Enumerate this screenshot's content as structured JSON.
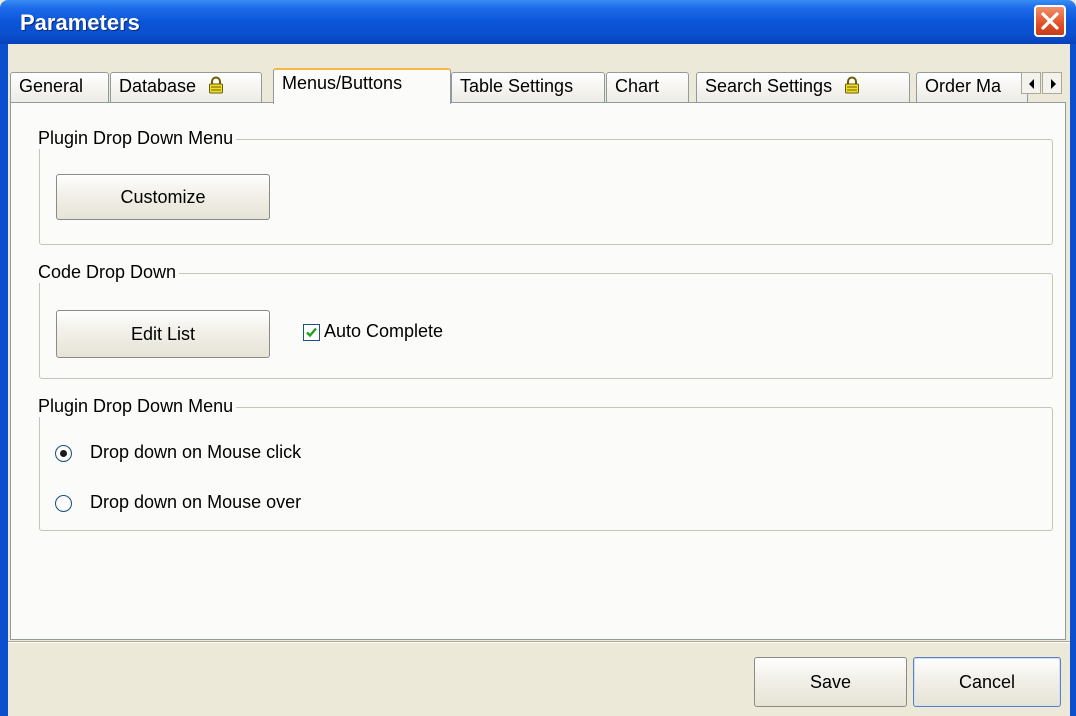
{
  "window": {
    "title": "Parameters"
  },
  "tabs": [
    {
      "label": "General",
      "locked": false
    },
    {
      "label": "Database",
      "locked": true
    },
    {
      "label": "Menus/Buttons",
      "locked": false,
      "active": true
    },
    {
      "label": "Table Settings",
      "locked": false
    },
    {
      "label": "Chart",
      "locked": false
    },
    {
      "label": "Search Settings",
      "locked": true
    },
    {
      "label": "Order Ma",
      "locked": false
    }
  ],
  "groups": {
    "plugin_menu": {
      "legend": "Plugin Drop Down Menu",
      "button_label": "Customize"
    },
    "code_drop_down": {
      "legend": "Code Drop Down",
      "button_label": "Edit List",
      "auto_complete": {
        "label": "Auto Complete",
        "checked": true
      }
    },
    "plugin_menu_behavior": {
      "legend": "Plugin Drop Down Menu",
      "options": [
        {
          "label": "Drop down on Mouse click",
          "selected": true
        },
        {
          "label": "Drop down on Mouse over",
          "selected": false
        }
      ]
    }
  },
  "footer": {
    "save_label": "Save",
    "cancel_label": "Cancel"
  },
  "colors": {
    "titlebar": "#0b4fce",
    "dialog_bg": "#ece9d8",
    "panel_bg": "#fbfbf9",
    "close": "#e0502a",
    "lock": "#e9d61c"
  },
  "icons": {
    "close": "close-icon",
    "lock": "lock-icon",
    "scroll_left": "arrow-left-icon",
    "scroll_right": "arrow-right-icon",
    "check": "checkmark-icon"
  }
}
